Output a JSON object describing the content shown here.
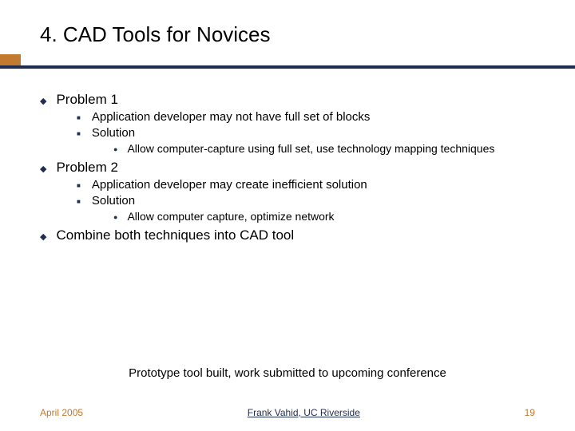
{
  "title": "4. CAD Tools for Novices",
  "bullets": {
    "p1": "Problem 1",
    "p1a": " Application developer may not have full set of blocks",
    "p1b": "Solution",
    "p1b1": "Allow computer-capture using full set, use technology mapping techniques",
    "p2": "Problem 2",
    "p2a": "Application developer may create inefficient solution",
    "p2b": "Solution",
    "p2b1": "Allow computer capture, optimize network",
    "p3": "Combine both techniques into CAD tool"
  },
  "note": "Prototype tool built, work submitted to upcoming conference",
  "footer": {
    "date": "April 2005",
    "author": "Frank Vahid, UC Riverside",
    "page": "19"
  }
}
